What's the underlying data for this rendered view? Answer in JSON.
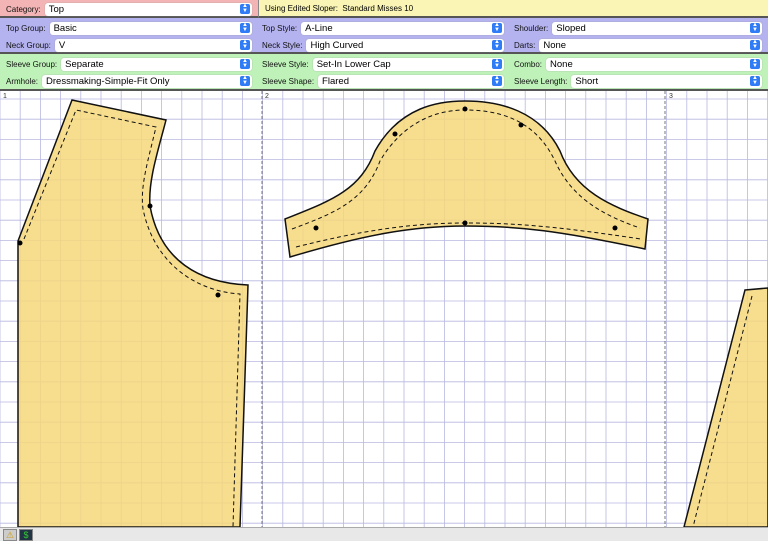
{
  "category": {
    "label": "Category:",
    "value": "Top"
  },
  "sloper": {
    "label": "Using Edited Sloper:",
    "value": "Standard Misses 10"
  },
  "top_group": {
    "label": "Top Group:",
    "value": "Basic"
  },
  "neck_group": {
    "label": "Neck Group:",
    "value": "V"
  },
  "top_style": {
    "label": "Top Style:",
    "value": "A-Line"
  },
  "neck_style": {
    "label": "Neck Style:",
    "value": "High Curved"
  },
  "shoulder": {
    "label": "Shoulder:",
    "value": "Sloped"
  },
  "darts": {
    "label": "Darts:",
    "value": "None"
  },
  "sleeve_group": {
    "label": "Sleeve Group:",
    "value": "Separate"
  },
  "armhole": {
    "label": "Armhole:",
    "value": "Dressmaking-Simple-Fit Only"
  },
  "sleeve_style": {
    "label": "Sleeve Style:",
    "value": "Set-In Lower Cap"
  },
  "sleeve_shape": {
    "label": "Sleeve Shape:",
    "value": "Flared"
  },
  "combo": {
    "label": "Combo:",
    "value": "None"
  },
  "sleeve_length": {
    "label": "Sleeve Length:",
    "value": "Short"
  },
  "pages": [
    "1",
    "2",
    "3"
  ],
  "colors": {
    "pattern_fill": "#f6d77a",
    "grid": "#b8b8e0",
    "category_band": "#f2b4b4",
    "sloper_band": "#faf5b5",
    "style_band": "#b4b2ef",
    "sleeve_band": "#bff2b9"
  },
  "status_icons": [
    "warning-icon",
    "dollar-icon"
  ]
}
